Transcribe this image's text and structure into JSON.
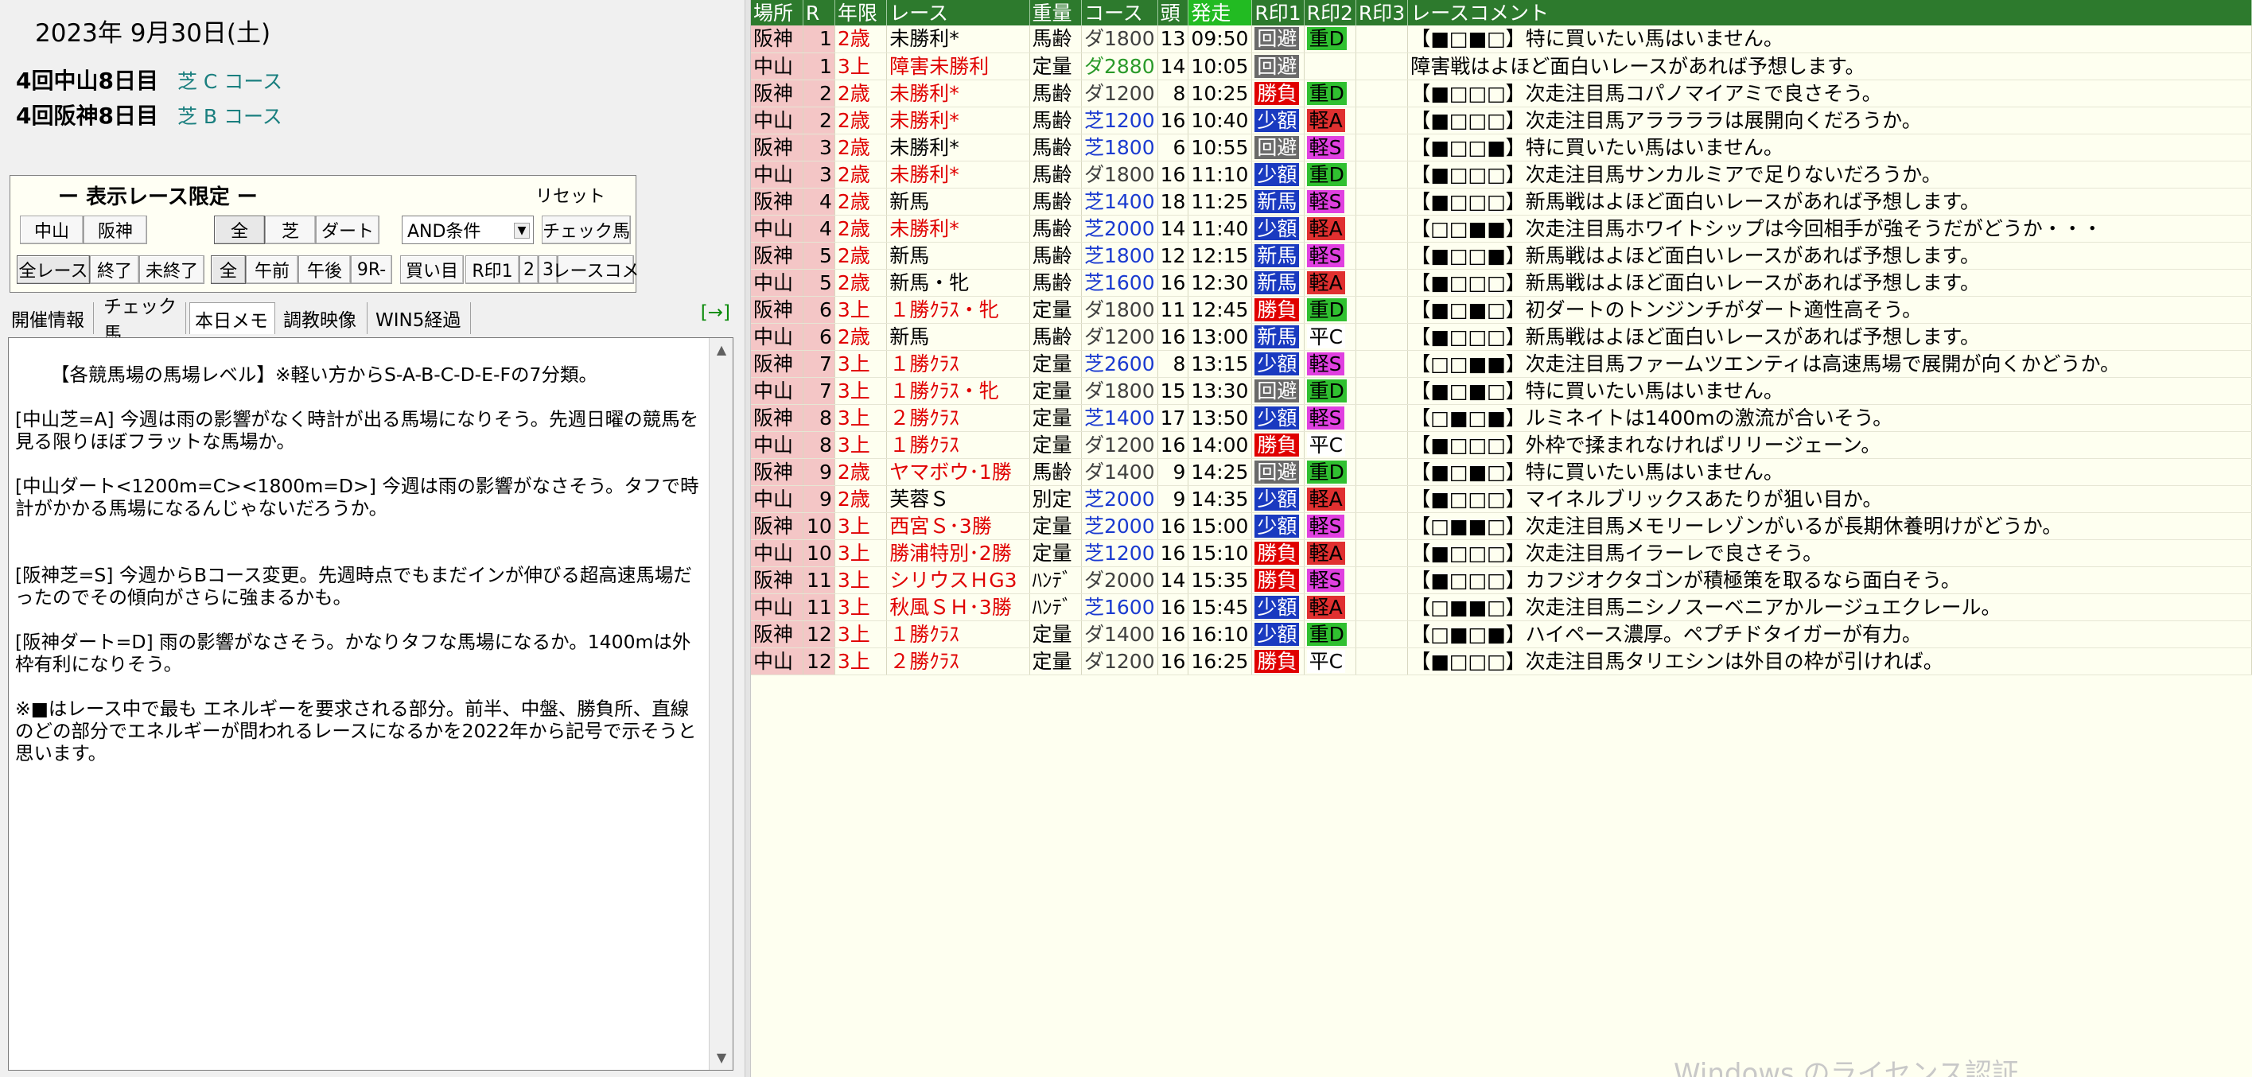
{
  "left": {
    "date": "2023年 9月30日(土)",
    "venues": [
      {
        "name": "4回中山8日目",
        "course": "芝 C コース"
      },
      {
        "name": "4回阪神8日目",
        "course": "芝 B コース"
      }
    ],
    "filter": {
      "title": "ー 表示レース限定 ー",
      "reset": "リセット",
      "row1": [
        "中山",
        "阪神",
        "全",
        "芝",
        "ダート"
      ],
      "condition_select": "AND条件",
      "check_horse": "チェック馬",
      "row2": [
        "全レース",
        "終了",
        "未終了",
        "全",
        "午前",
        "午後",
        "9R-",
        "買い目",
        "R印1",
        "2",
        "3",
        "レースコメ"
      ]
    },
    "tabs": [
      "開催情報",
      "チェック馬",
      "本日メモ",
      "調教映像",
      "WIN5経過"
    ],
    "tab_arrow": "[→]",
    "memo": "【各競馬場の馬場レベル】※軽い方からS-A-B-C-D-E-Fの7分類。\n\n[中山芝=A] 今週は雨の影響がなく時計が出る馬場になりそう。先週日曜の競馬を見る限りほぼフラットな馬場か。\n\n[中山ダート<1200m=C><1800m=D>] 今週は雨の影響がなさそう。タフで時計がかかる馬場になるんじゃないだろうか。\n\n\n[阪神芝=S] 今週からBコース変更。先週時点でもまだインが伸びる超高速馬場だったのでその傾向がさらに強まるかも。\n\n[阪神ダート=D] 雨の影響がなさそう。かなりタフな馬場になるか。1400mは外枠有利になりそう。\n\n※■はレース中で最も エネルギーを要求される部分。前半、中盤、勝負所、直線のどの部分でエネルギーが問われるレースになるかを2022年から記号で示そうと思います。"
  },
  "table": {
    "headers": [
      "場所",
      "R",
      "年限",
      "レース",
      "重量",
      "コース",
      "頭",
      "発走",
      "R印1",
      "R印2",
      "R印3",
      "レースコメント"
    ],
    "rows": [
      {
        "place": "阪神",
        "r": "1",
        "age": "2歳",
        "race": "未勝利*",
        "race_red": false,
        "weight": "馬齢",
        "course": "ダ1800",
        "surface": "dirt",
        "heads": "13",
        "time": "09:50",
        "mark": "回避",
        "mark_type": "kaihi",
        "cond": "重D",
        "cond_type": "D",
        "comment": "【■□■□】特に買いたい馬はいません。"
      },
      {
        "place": "中山",
        "r": "1",
        "age": "3上",
        "race": "障害未勝利",
        "race_red": true,
        "weight": "定量",
        "course": "ダ2880",
        "surface": "jump",
        "heads": "14",
        "time": "10:05",
        "mark": "回避",
        "mark_type": "kaihi",
        "cond": "",
        "cond_type": "",
        "comment": "障害戦はよほど面白いレースがあれば予想します。"
      },
      {
        "place": "阪神",
        "r": "2",
        "age": "2歳",
        "race": "未勝利*",
        "race_red": true,
        "weight": "馬齢",
        "course": "ダ1200",
        "surface": "dirt",
        "heads": "8",
        "time": "10:25",
        "mark": "勝負",
        "mark_type": "shoubu",
        "cond": "重D",
        "cond_type": "D",
        "comment": "【■□□□】次走注目馬コパノマイアミで良さそう。"
      },
      {
        "place": "中山",
        "r": "2",
        "age": "2歳",
        "race": "未勝利*",
        "race_red": true,
        "weight": "馬齢",
        "course": "芝1200",
        "surface": "turf",
        "heads": "16",
        "time": "10:40",
        "mark": "少額",
        "mark_type": "shogaku",
        "cond": "軽A",
        "cond_type": "A",
        "comment": "【■□□□】次走注目馬アララララは展開向くだろうか。"
      },
      {
        "place": "阪神",
        "r": "3",
        "age": "2歳",
        "race": "未勝利*",
        "race_red": false,
        "weight": "馬齢",
        "course": "芝1800",
        "surface": "turf",
        "heads": "6",
        "time": "10:55",
        "mark": "回避",
        "mark_type": "kaihi",
        "cond": "軽S",
        "cond_type": "S",
        "comment": "【■□□■】特に買いたい馬はいません。"
      },
      {
        "place": "中山",
        "r": "3",
        "age": "2歳",
        "race": "未勝利*",
        "race_red": true,
        "weight": "馬齢",
        "course": "ダ1800",
        "surface": "dirt",
        "heads": "16",
        "time": "11:10",
        "mark": "少額",
        "mark_type": "shogaku",
        "cond": "重D",
        "cond_type": "D",
        "comment": "【■□□□】次走注目馬サンカルミアで足りないだろうか。"
      },
      {
        "place": "阪神",
        "r": "4",
        "age": "2歳",
        "race": "新馬",
        "race_red": false,
        "weight": "馬齢",
        "course": "芝1400",
        "surface": "turf",
        "heads": "18",
        "time": "11:25",
        "mark": "新馬",
        "mark_type": "shinba",
        "cond": "軽S",
        "cond_type": "S",
        "comment": "【■□□□】新馬戦はよほど面白いレースがあれば予想します。"
      },
      {
        "place": "中山",
        "r": "4",
        "age": "2歳",
        "race": "未勝利*",
        "race_red": true,
        "weight": "馬齢",
        "course": "芝2000",
        "surface": "turf",
        "heads": "14",
        "time": "11:40",
        "mark": "少額",
        "mark_type": "shogaku",
        "cond": "軽A",
        "cond_type": "A",
        "comment": "【□□■■】次走注目馬ホワイトシップは今回相手が強そうだがどうか・・・"
      },
      {
        "place": "阪神",
        "r": "5",
        "age": "2歳",
        "race": "新馬",
        "race_red": false,
        "weight": "馬齢",
        "course": "芝1800",
        "surface": "turf",
        "heads": "12",
        "time": "12:15",
        "mark": "新馬",
        "mark_type": "shinba",
        "cond": "軽S",
        "cond_type": "S",
        "comment": "【■□□■】新馬戦はよほど面白いレースがあれば予想します。"
      },
      {
        "place": "中山",
        "r": "5",
        "age": "2歳",
        "race": "新馬・牝",
        "race_red": false,
        "weight": "馬齢",
        "course": "芝1600",
        "surface": "turf",
        "heads": "16",
        "time": "12:30",
        "mark": "新馬",
        "mark_type": "shinba",
        "cond": "軽A",
        "cond_type": "A",
        "comment": "【■□□□】新馬戦はよほど面白いレースがあれば予想します。"
      },
      {
        "place": "阪神",
        "r": "6",
        "age": "3上",
        "race": "１勝ｸﾗｽ・牝",
        "race_red": true,
        "weight": "定量",
        "course": "ダ1800",
        "surface": "dirt",
        "heads": "11",
        "time": "12:45",
        "mark": "勝負",
        "mark_type": "shoubu",
        "cond": "重D",
        "cond_type": "D",
        "comment": "【■□■□】初ダートのトンジンチがダート適性高そう。"
      },
      {
        "place": "中山",
        "r": "6",
        "age": "2歳",
        "race": "新馬",
        "race_red": false,
        "weight": "馬齢",
        "course": "ダ1200",
        "surface": "dirt",
        "heads": "16",
        "time": "13:00",
        "mark": "新馬",
        "mark_type": "shinba",
        "cond": "平C",
        "cond_type": "C",
        "comment": "【■□□□】新馬戦はよほど面白いレースがあれば予想します。"
      },
      {
        "place": "阪神",
        "r": "7",
        "age": "3上",
        "race": "１勝ｸﾗｽ",
        "race_red": true,
        "weight": "定量",
        "course": "芝2600",
        "surface": "turf",
        "heads": "8",
        "time": "13:15",
        "mark": "少額",
        "mark_type": "shogaku",
        "cond": "軽S",
        "cond_type": "S",
        "comment": "【□□■■】次走注目馬ファームツエンティは高速馬場で展開が向くかどうか。"
      },
      {
        "place": "中山",
        "r": "7",
        "age": "3上",
        "race": "１勝ｸﾗｽ・牝",
        "race_red": true,
        "weight": "定量",
        "course": "ダ1800",
        "surface": "dirt",
        "heads": "15",
        "time": "13:30",
        "mark": "回避",
        "mark_type": "kaihi",
        "cond": "重D",
        "cond_type": "D",
        "comment": "【■□■□】特に買いたい馬はいません。"
      },
      {
        "place": "阪神",
        "r": "8",
        "age": "3上",
        "race": "２勝ｸﾗｽ",
        "race_red": true,
        "weight": "定量",
        "course": "芝1400",
        "surface": "turf",
        "heads": "17",
        "time": "13:50",
        "mark": "少額",
        "mark_type": "shogaku",
        "cond": "軽S",
        "cond_type": "S",
        "comment": "【□■□■】ルミネイトは1400mの激流が合いそう。"
      },
      {
        "place": "中山",
        "r": "8",
        "age": "3上",
        "race": "１勝ｸﾗｽ",
        "race_red": true,
        "weight": "定量",
        "course": "ダ1200",
        "surface": "dirt",
        "heads": "16",
        "time": "14:00",
        "mark": "勝負",
        "mark_type": "shoubu",
        "cond": "平C",
        "cond_type": "C",
        "comment": "【■□□□】外枠で揉まれなければリリージェーン。"
      },
      {
        "place": "阪神",
        "r": "9",
        "age": "2歳",
        "race": "ヤマボウ･1勝",
        "race_red": true,
        "weight": "馬齢",
        "course": "ダ1400",
        "surface": "dirt",
        "heads": "9",
        "time": "14:25",
        "mark": "回避",
        "mark_type": "kaihi",
        "cond": "重D",
        "cond_type": "D",
        "comment": "【■□■□】特に買いたい馬はいません。"
      },
      {
        "place": "中山",
        "r": "9",
        "age": "2歳",
        "race": "芙蓉Ｓ",
        "race_red": false,
        "weight": "別定",
        "course": "芝2000",
        "surface": "turf",
        "heads": "9",
        "time": "14:35",
        "mark": "少額",
        "mark_type": "shogaku",
        "cond": "軽A",
        "cond_type": "A",
        "comment": "【■□□□】マイネルブリックスあたりが狙い目か。"
      },
      {
        "place": "阪神",
        "r": "10",
        "age": "3上",
        "race": "西宮Ｓ･3勝",
        "race_red": true,
        "weight": "定量",
        "course": "芝2000",
        "surface": "turf",
        "heads": "16",
        "time": "15:00",
        "mark": "少額",
        "mark_type": "shogaku",
        "cond": "軽S",
        "cond_type": "S",
        "comment": "【□■■□】次走注目馬メモリーレゾンがいるが長期休養明けがどうか。"
      },
      {
        "place": "中山",
        "r": "10",
        "age": "3上",
        "race": "勝浦特別･2勝",
        "race_red": true,
        "weight": "定量",
        "course": "芝1200",
        "surface": "turf",
        "heads": "16",
        "time": "15:10",
        "mark": "勝負",
        "mark_type": "shoubu",
        "cond": "軽A",
        "cond_type": "A",
        "comment": "【■□□□】次走注目馬イラーレで良さそう。"
      },
      {
        "place": "阪神",
        "r": "11",
        "age": "3上",
        "race": "シリウスＨG3",
        "race_red": true,
        "weight": "ﾊﾝﾃﾞ",
        "course": "ダ2000",
        "surface": "dirt",
        "heads": "14",
        "time": "15:35",
        "mark": "勝負",
        "mark_type": "shoubu",
        "cond": "軽S",
        "cond_type": "S",
        "comment": "【■□□□】カフジオクタゴンが積極策を取るなら面白そう。"
      },
      {
        "place": "中山",
        "r": "11",
        "age": "3上",
        "race": "秋風ＳＨ･3勝",
        "race_red": true,
        "weight": "ﾊﾝﾃﾞ",
        "course": "芝1600",
        "surface": "turf",
        "heads": "16",
        "time": "15:45",
        "mark": "少額",
        "mark_type": "shogaku",
        "cond": "軽A",
        "cond_type": "A",
        "comment": "【□■■□】次走注目馬ニシノスーベニアかルージュエクレール。"
      },
      {
        "place": "阪神",
        "r": "12",
        "age": "3上",
        "race": "１勝ｸﾗｽ",
        "race_red": true,
        "weight": "定量",
        "course": "ダ1400",
        "surface": "dirt",
        "heads": "16",
        "time": "16:10",
        "mark": "少額",
        "mark_type": "shogaku",
        "cond": "重D",
        "cond_type": "D",
        "comment": "【□■□■】ハイペース濃厚。ペプチドタイガーが有力。"
      },
      {
        "place": "中山",
        "r": "12",
        "age": "3上",
        "race": "２勝ｸﾗｽ",
        "race_red": true,
        "weight": "定量",
        "course": "ダ1200",
        "surface": "dirt",
        "heads": "16",
        "time": "16:25",
        "mark": "勝負",
        "mark_type": "shoubu",
        "cond": "平C",
        "cond_type": "C",
        "comment": "【■□□□】次走注目馬タリエシンは外目の枠が引ければ。"
      }
    ]
  },
  "watermark": "Windows のライセンス認証"
}
